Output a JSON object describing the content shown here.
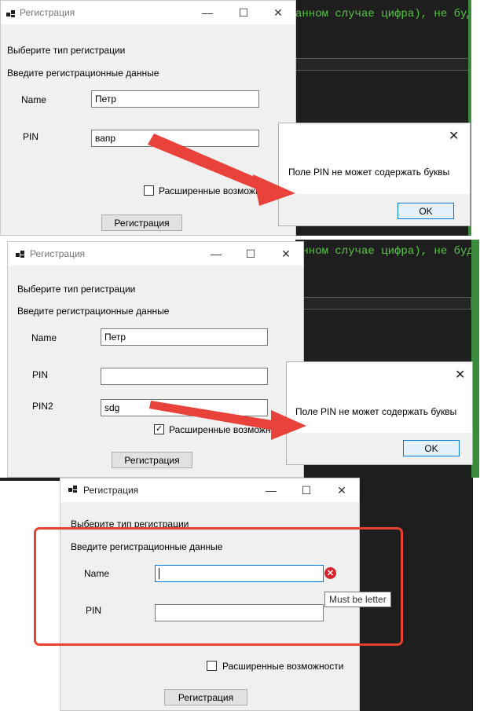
{
  "editor": {
    "code_fragment": "анном случае цифра), не будет"
  },
  "colors": {
    "arrow": "#e8423a",
    "highlight_box": "#e64232",
    "editor_bg": "#1e1e1e",
    "code_green": "#57c443"
  },
  "window1": {
    "title": "Регистрация",
    "select_type_label": "Выберите тип регистрации",
    "enter_data_label": "Введите регистрационные данные",
    "name_label": "Name",
    "name_value": "Петр",
    "pin_label": "PIN",
    "pin_value": "вапр",
    "advanced_label": "Расширенные возможности",
    "advanced_checked": false,
    "register_button": "Регистрация"
  },
  "msgbox1": {
    "message": "Поле PIN не может содержать буквы",
    "ok_label": "OK"
  },
  "window2": {
    "title": "Регистрация",
    "select_type_label": "Выберите тип регистрации",
    "enter_data_label": "Введите регистрационные данные",
    "name_label": "Name",
    "name_value": "Петр",
    "pin_label": "PIN",
    "pin_value": "",
    "pin2_label": "PIN2",
    "pin2_value": "sdg",
    "advanced_label": "Расширенные возможности",
    "advanced_checked": true,
    "register_button": "Регистрация"
  },
  "msgbox2": {
    "message": "Поле PIN не может содержать буквы",
    "ok_label": "OK"
  },
  "window3": {
    "title": "Регистрация",
    "select_type_label": "Выберите тип регистрации",
    "enter_data_label": "Введите регистрационные данные",
    "name_label": "Name",
    "name_value": "",
    "pin_label": "PIN",
    "pin_value": "",
    "error_tooltip": "Must be letter",
    "advanced_label": "Расширенные возможности",
    "advanced_checked": false,
    "register_button": "Регистрация"
  },
  "titlebar_icons": {
    "minimize": "minimize-icon",
    "maximize": "maximize-icon",
    "close": "close-icon",
    "app": "app-icon"
  }
}
